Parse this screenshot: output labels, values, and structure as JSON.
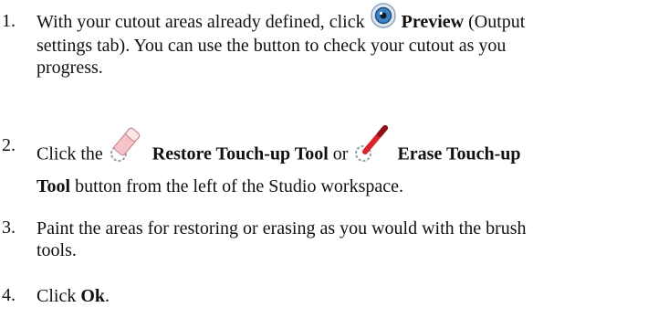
{
  "steps": [
    {
      "number": "1.",
      "line1_pre": "With your cutout areas already defined, click",
      "line1_bold": "Preview",
      "line1_post": "(Output",
      "line2": "settings tab). You can use the button to check your cutout as you",
      "line3": "progress.",
      "icon": "preview-eye-icon"
    },
    {
      "number": "2.",
      "pre": "Click the",
      "restore_bold": "Restore Touch-up Tool",
      "or": "or",
      "erase_bold_line1": "Erase Touch-up",
      "erase_bold_line2": "Tool",
      "post": "button from the left of the Studio workspace.",
      "icons": [
        "restore-eraser-icon",
        "erase-brush-icon"
      ]
    },
    {
      "number": "3.",
      "line1": "Paint the areas for restoring or erasing as you would with the brush",
      "line2": "tools."
    },
    {
      "number": "4.",
      "pre": "Click",
      "bold": "Ok",
      "post": "."
    }
  ],
  "colors": {
    "text": "#111111",
    "preview_icon_blue": "#3b82c4",
    "eraser_pink": "#f2a0a8",
    "brush_red": "#d8232a"
  }
}
